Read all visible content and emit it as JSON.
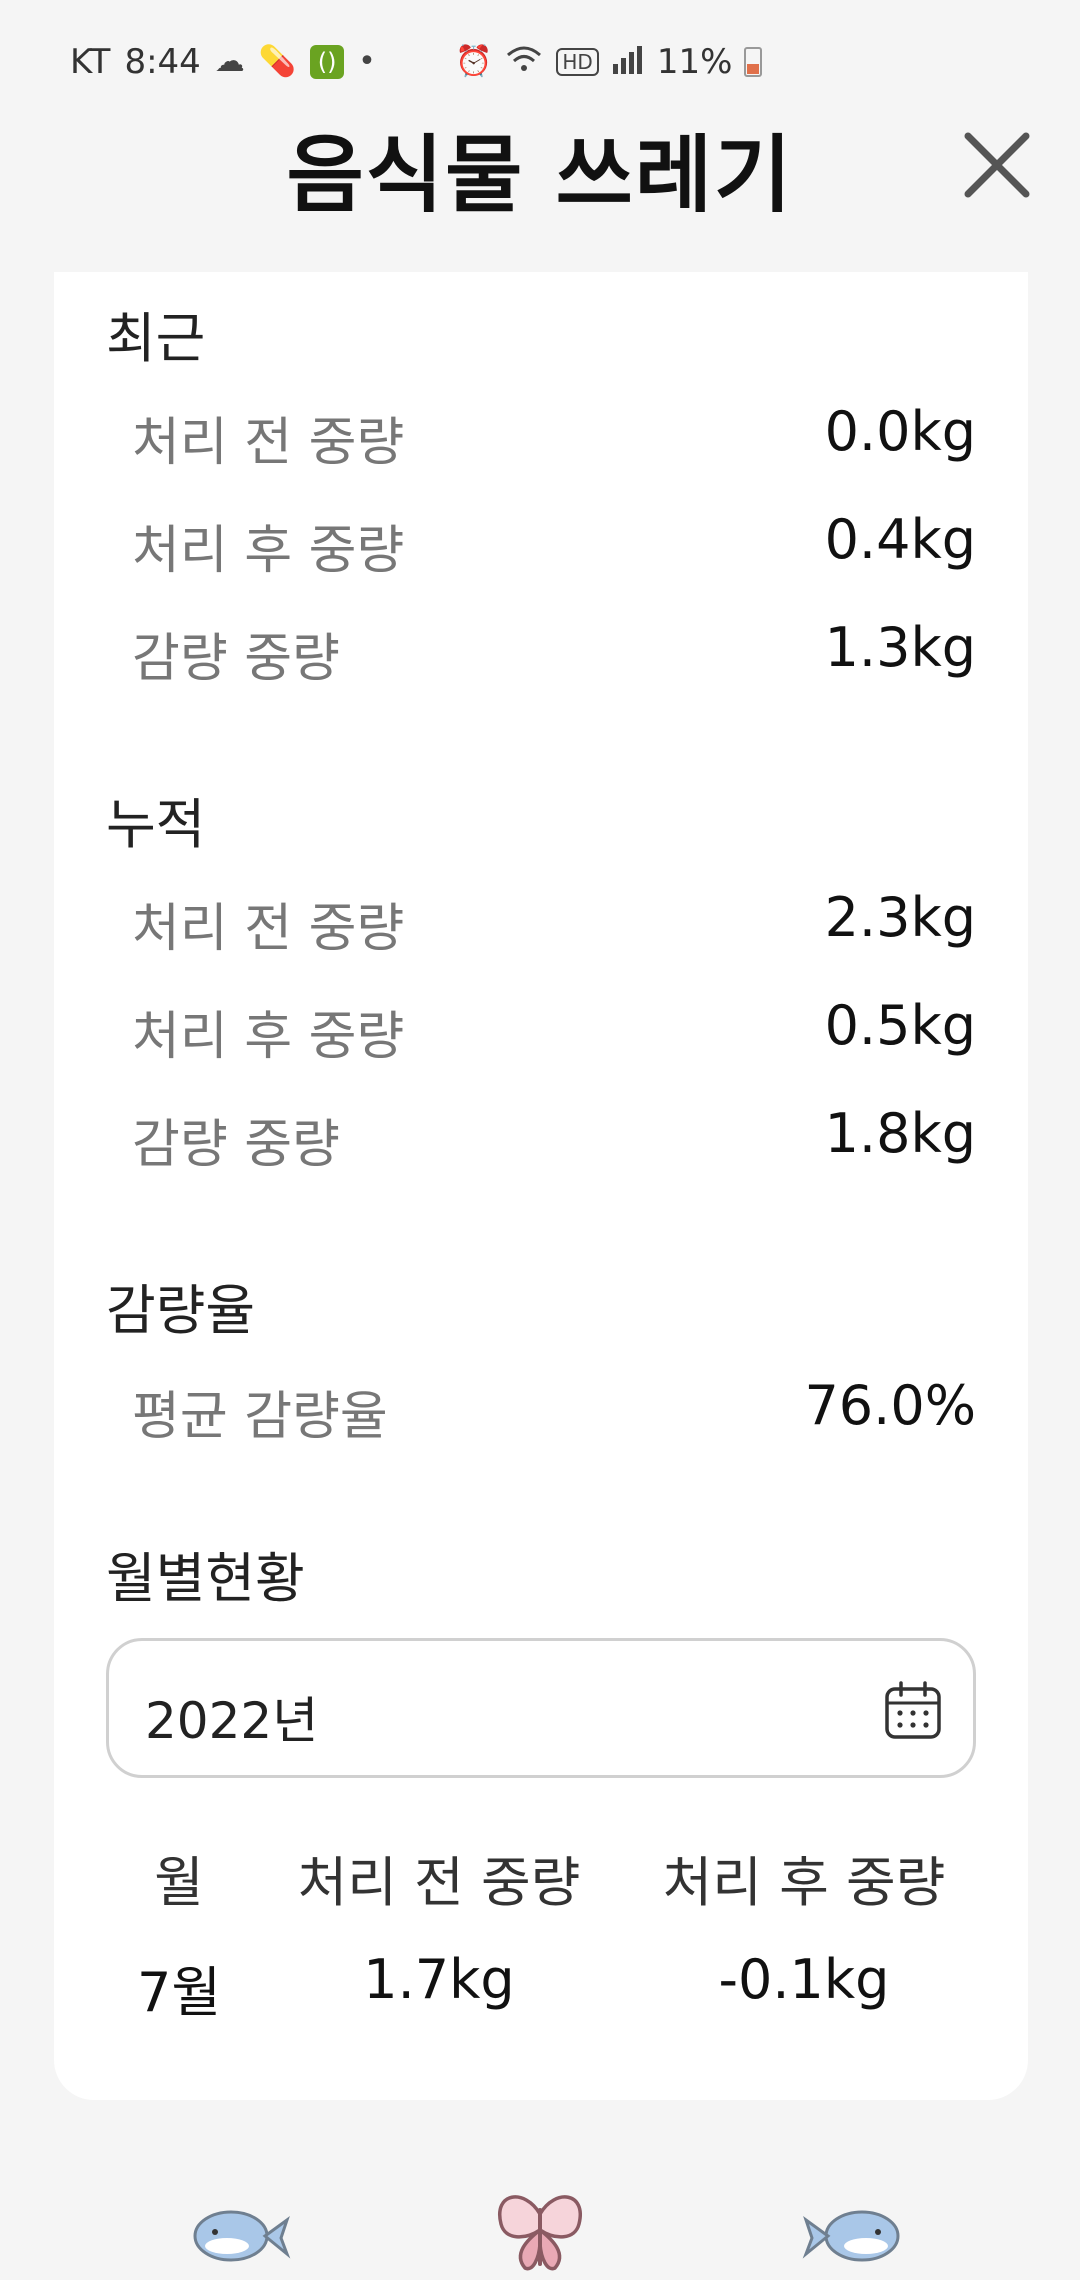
{
  "status_bar": {
    "carrier": "KT",
    "time": "8:44",
    "battery": "11%",
    "icons_left": [
      "cloud-icon",
      "pill-icon",
      "green-app-icon",
      "dot-icon"
    ],
    "icons_right": [
      "alarm-icon",
      "wifi-icon",
      "hd-icon",
      "signal-icon",
      "battery-icon"
    ],
    "green_app_glyph": "()",
    "hd_label": "HD"
  },
  "header": {
    "title": "음식물 쓰레기"
  },
  "recent": {
    "title": "최근",
    "rows": [
      {
        "label": "처리 전 중량",
        "value": "0.0kg"
      },
      {
        "label": "처리 후 중량",
        "value": "0.4kg"
      },
      {
        "label": "감량 중량",
        "value": "1.3kg"
      }
    ]
  },
  "cumulative": {
    "title": "누적",
    "rows": [
      {
        "label": "처리 전 중량",
        "value": "2.3kg"
      },
      {
        "label": "처리 후 중량",
        "value": "0.5kg"
      },
      {
        "label": "감량 중량",
        "value": "1.8kg"
      }
    ]
  },
  "reduction": {
    "title": "감량율",
    "rows": [
      {
        "label": "평균 감량율",
        "value": "76.0%"
      }
    ]
  },
  "monthly": {
    "title": "월별현황",
    "year": "2022년",
    "columns": [
      "월",
      "처리 전 중량",
      "처리 후 중량"
    ],
    "rows": [
      [
        "7월",
        "1.7kg",
        "-0.1kg"
      ]
    ]
  },
  "colors": {
    "background": "#f5f5f5",
    "card": "#ffffff",
    "label_gray": "#777777",
    "whale_blue": "#a9c7e8",
    "butterfly_pink": "#e9a9b5"
  },
  "bottom_nav": {
    "icons": [
      "whale-icon",
      "butterfly-icon",
      "whale-icon"
    ]
  }
}
